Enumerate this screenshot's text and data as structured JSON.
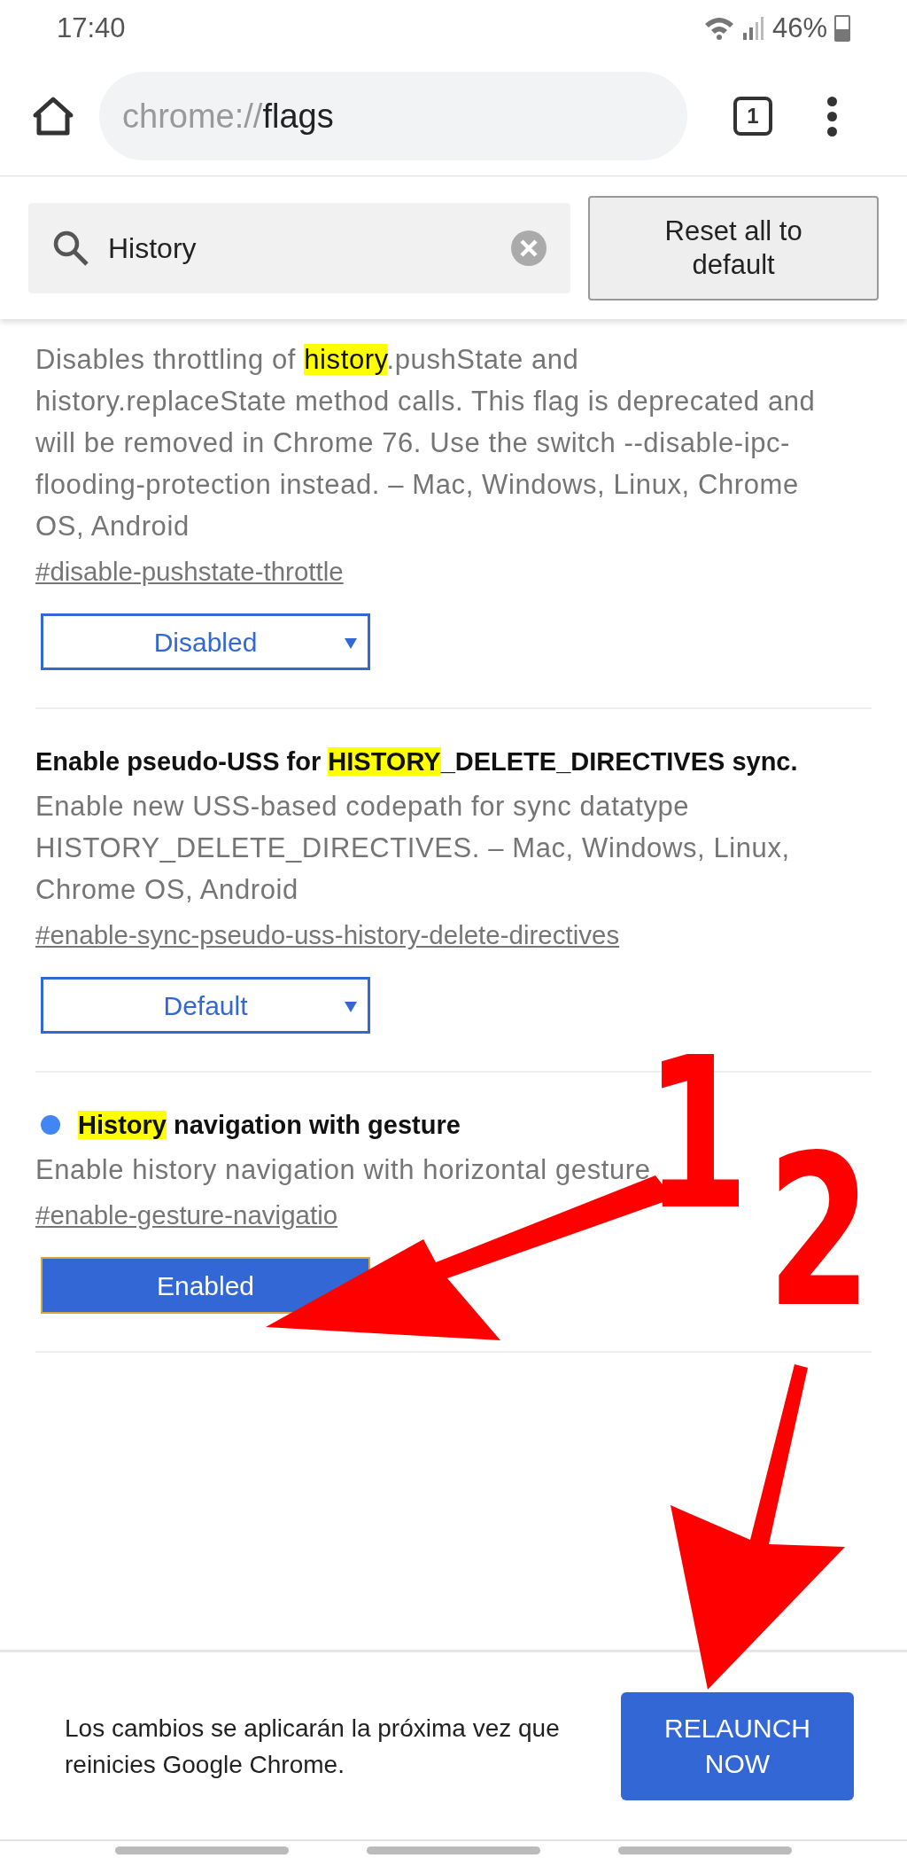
{
  "status_bar": {
    "time": "17:40",
    "battery": "46%"
  },
  "toolbar": {
    "url_scheme": "chrome://",
    "url_host": "flags",
    "tab_count": "1"
  },
  "search": {
    "value": "History"
  },
  "reset_button": "Reset all to default",
  "flags": [
    {
      "modified": false,
      "description_parts": [
        {
          "text": "Disables throttling of ",
          "match": false
        },
        {
          "text": "history",
          "match": true
        },
        {
          "text": ".pushState and history.replaceState method calls. This flag is deprecated and will be removed in Chrome 76. Use the switch --disable-ipc-flooding-protection instead. – Mac, Windows, Linux, Chrome OS, Android",
          "match": false
        }
      ],
      "link": "#disable-pushstate-throttle",
      "value": "Disabled",
      "highlighted": false
    },
    {
      "title_parts": [
        {
          "text": "Enable pseudo-USS for ",
          "match": false
        },
        {
          "text": "HISTORY",
          "match": true
        },
        {
          "text": "_DELETE_DIRECTIVES sync.",
          "match": false
        }
      ],
      "modified": false,
      "description_parts": [
        {
          "text": "Enable new USS-based codepath for sync datatype HISTORY_DELETE_DIRECTIVES. – Mac, Windows, Linux, Chrome OS, Android",
          "match": false
        }
      ],
      "link": "#enable-sync-pseudo-uss-history-delete-directives",
      "value": "Default",
      "highlighted": false
    },
    {
      "title_parts": [
        {
          "text": "History",
          "match": true
        },
        {
          "text": " navigation with gesture",
          "match": false
        }
      ],
      "modified": true,
      "description_parts": [
        {
          "text": "Enable history navigation with horizontal gesture",
          "match": false
        }
      ],
      "link": "#enable-gesture-navigatio",
      "value": "Enabled",
      "highlighted": true
    }
  ],
  "relaunch_bar": {
    "message": "Los cambios se aplicarán la próxima vez que reinicies Google Chrome.",
    "button": "RELAUNCH NOW"
  },
  "annotations": [
    {
      "label": "1"
    },
    {
      "label": "2"
    }
  ]
}
